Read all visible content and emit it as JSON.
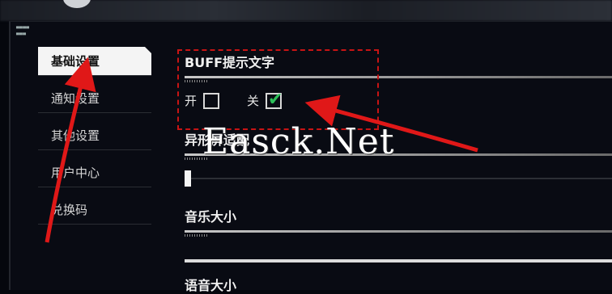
{
  "sidebar": {
    "items": [
      {
        "label": "基础设置",
        "active": true
      },
      {
        "label": "通知设置",
        "active": false
      },
      {
        "label": "其他设置",
        "active": false
      },
      {
        "label": "用户中心",
        "active": false
      },
      {
        "label": "兑换码",
        "active": false
      }
    ]
  },
  "content": {
    "buff": {
      "title": "BUFF提示文字",
      "on_label": "开",
      "off_label": "关",
      "on_checked": false,
      "off_checked": true
    },
    "screen_adapt": {
      "title": "异形屏适配",
      "value": 0
    },
    "music_volume": {
      "title": "音乐大小"
    },
    "voice_volume": {
      "title": "语音大小"
    }
  },
  "watermark": {
    "text": "Easck.Net"
  },
  "colors": {
    "accent_red": "#c81414",
    "check_green": "#2ec05a",
    "active_tab_bg": "#f4f4f4",
    "panel_bg": "#090b13"
  },
  "icons": {
    "checkmark": "check-icon",
    "annotation": "arrow-icon"
  }
}
